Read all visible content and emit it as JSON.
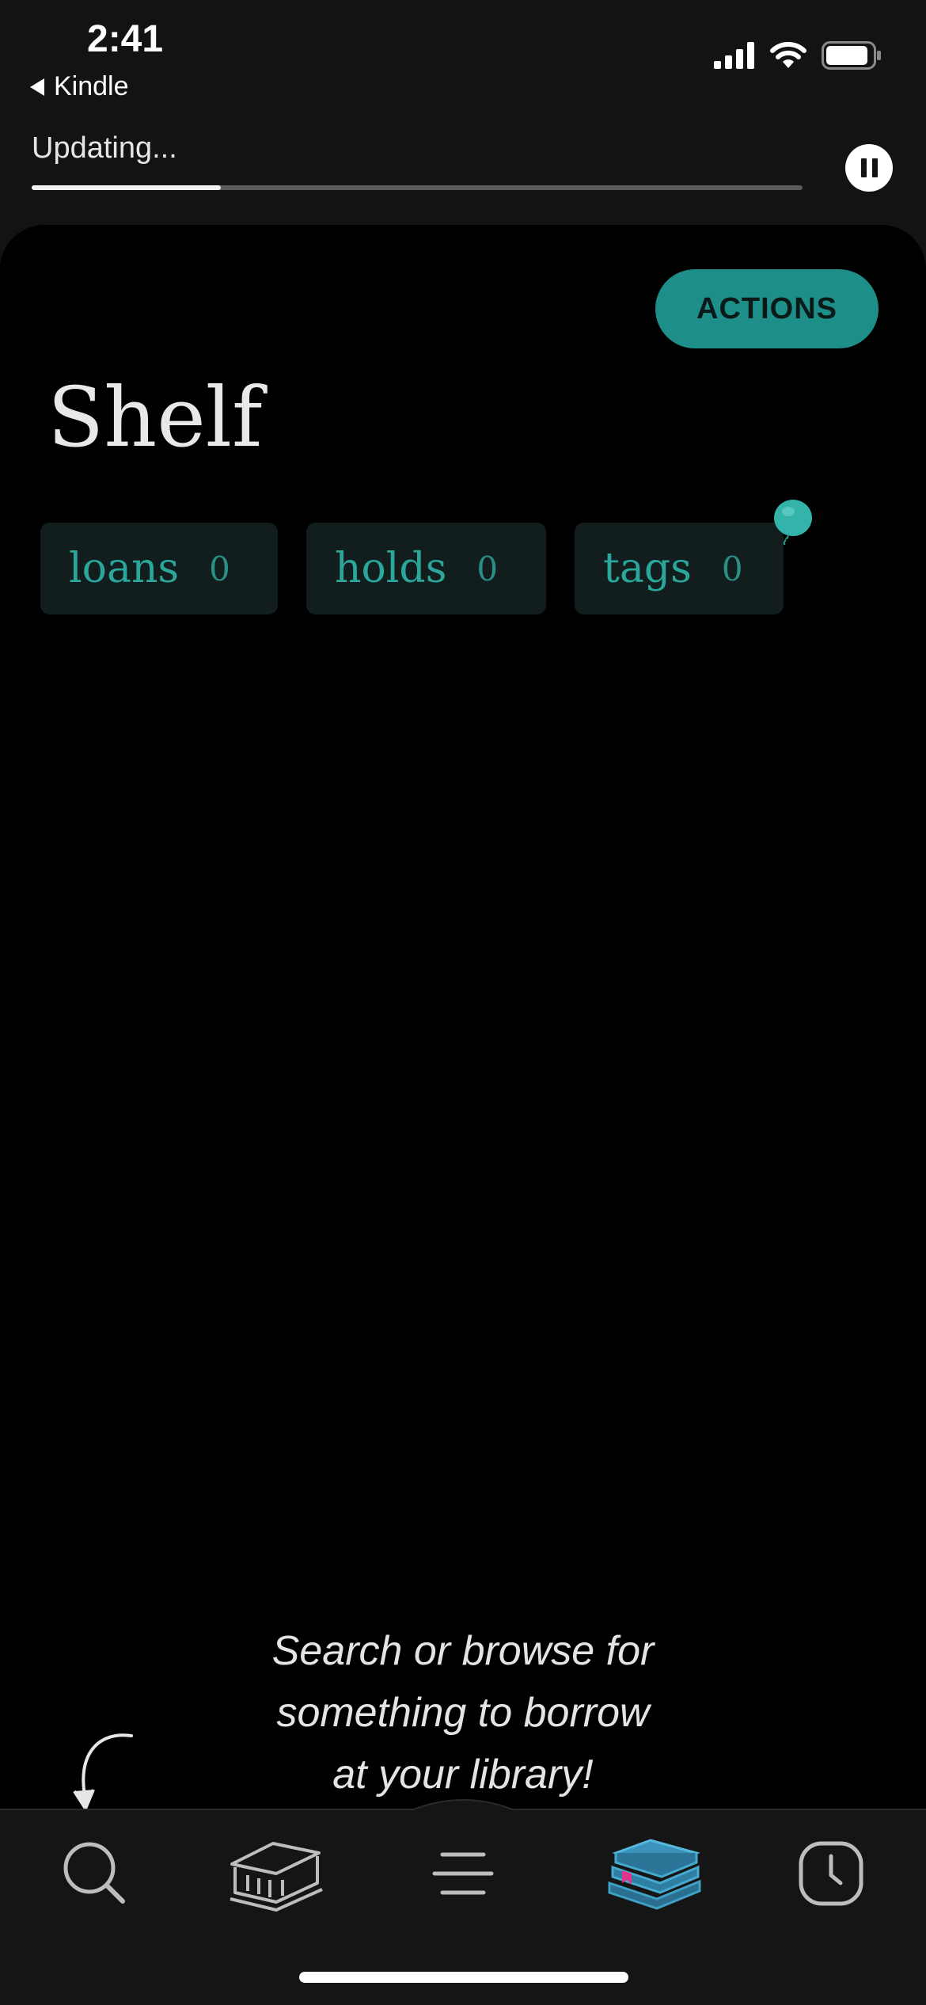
{
  "status_bar": {
    "time": "2:41",
    "back_label": "Kindle",
    "icons": [
      "cellular-signal-icon",
      "wifi-icon",
      "battery-icon"
    ]
  },
  "update": {
    "label": "Updating...",
    "progress": 0.245,
    "pause_icon": "pause-icon"
  },
  "header": {
    "actions_label": "ACTIONS",
    "title": "Shelf"
  },
  "chips": [
    {
      "label": "loans",
      "count": "0"
    },
    {
      "label": "holds",
      "count": "0"
    },
    {
      "label": "tags",
      "count": "0"
    }
  ],
  "empty_state": {
    "line1": "Search or browse for",
    "line2": "something to borrow",
    "line3": "at your library!"
  },
  "tab_bar": {
    "items": [
      {
        "icon": "search-icon",
        "active": false
      },
      {
        "icon": "library-icon",
        "active": false
      },
      {
        "icon": "menu-icon",
        "active": false
      },
      {
        "icon": "shelf-books-icon",
        "active": true
      },
      {
        "icon": "clock-icon",
        "active": false
      }
    ]
  },
  "colors": {
    "accent": "#1e8f88",
    "chip_text": "#2aa69b",
    "background": "#000000",
    "chrome": "#131313",
    "bookmark": "#e0338a"
  }
}
